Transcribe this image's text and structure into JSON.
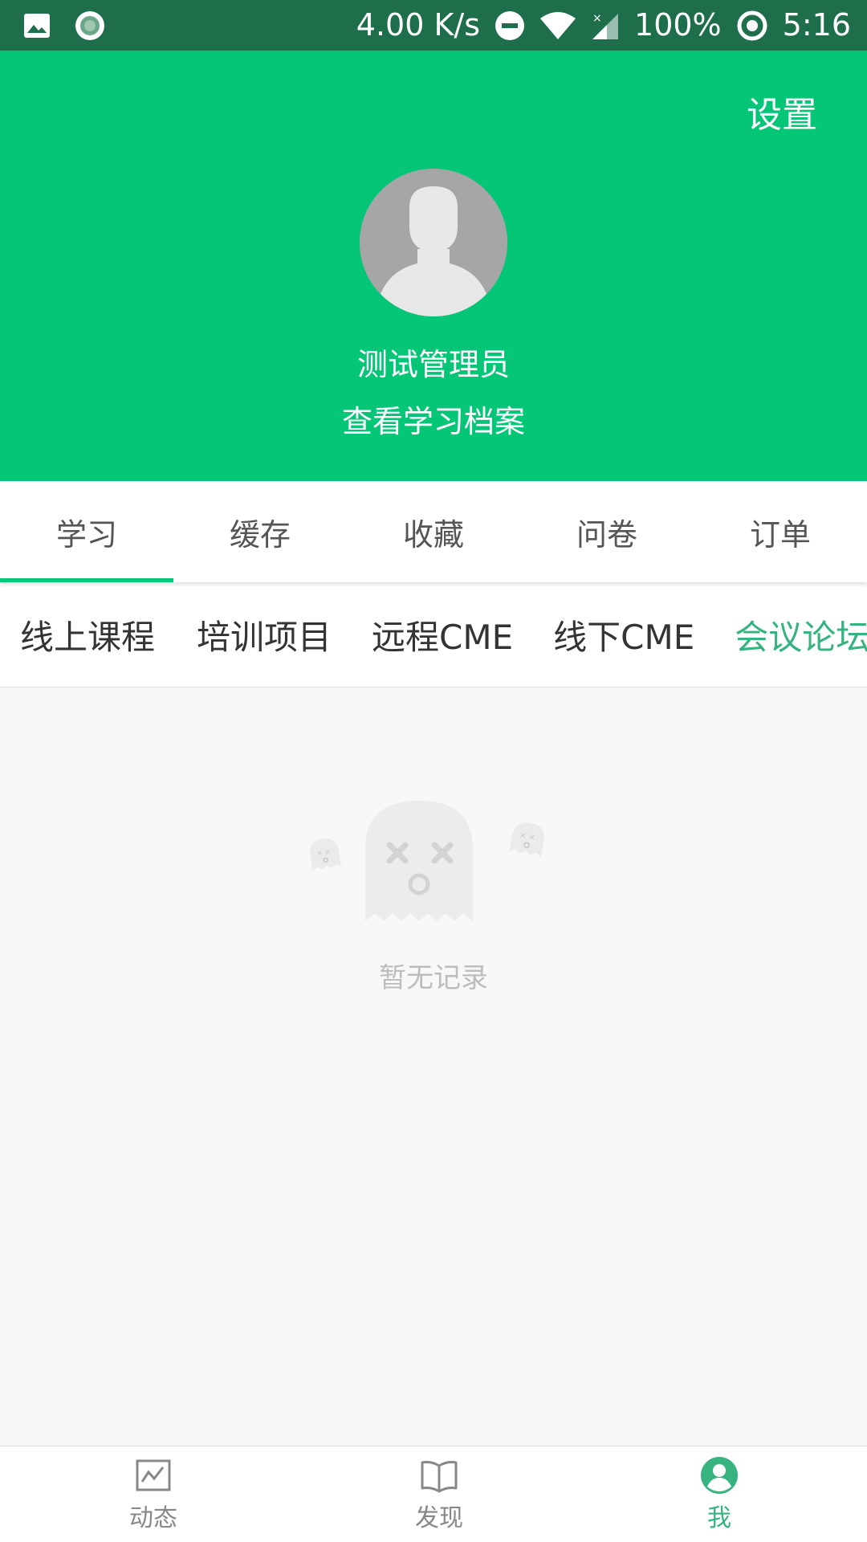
{
  "status_bar": {
    "speed": "4.00 K/s",
    "battery": "100%",
    "time": "5:16",
    "icons": [
      "image-icon",
      "record-icon",
      "dnd-icon",
      "wifi-icon",
      "signal-icon",
      "sync-icon"
    ]
  },
  "header": {
    "settings_label": "设置",
    "username": "测试管理员",
    "profile_link": "查看学习档案",
    "bg_color": "#05c677"
  },
  "main_tabs": [
    {
      "label": "学习",
      "active": true
    },
    {
      "label": "缓存",
      "active": false
    },
    {
      "label": "收藏",
      "active": false
    },
    {
      "label": "问卷",
      "active": false
    },
    {
      "label": "订单",
      "active": false
    }
  ],
  "sub_tabs": [
    {
      "label": "线上课程",
      "active": false
    },
    {
      "label": "培训项目",
      "active": false
    },
    {
      "label": "远程CME",
      "active": false
    },
    {
      "label": "线下CME",
      "active": false
    },
    {
      "label": "会议论坛",
      "active": true
    }
  ],
  "empty_state": {
    "icon": "ghost-icon",
    "text": "暂无记录"
  },
  "bottom_nav": [
    {
      "label": "动态",
      "icon": "trend-chart-icon",
      "active": false
    },
    {
      "label": "发现",
      "icon": "open-book-icon",
      "active": false
    },
    {
      "label": "我",
      "icon": "user-circle-icon",
      "active": true
    }
  ],
  "colors": {
    "accent": "#05c677",
    "active_text": "#36b37e",
    "status_bar": "#1e6e4c"
  }
}
